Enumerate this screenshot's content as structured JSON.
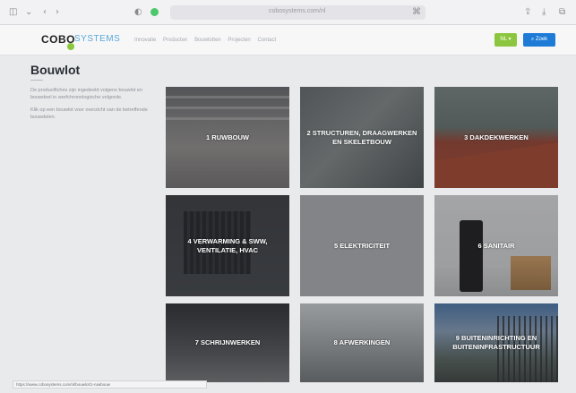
{
  "browser": {
    "back_icon": "chevron-left",
    "url": "cobosystems.com/nl"
  },
  "header": {
    "logo": {
      "brand": "COBO",
      "suffix": "SYSTEMS"
    },
    "nav": [
      "Innovatie",
      "Producten",
      "Bouwlotten",
      "Projecten",
      "Contact"
    ],
    "nl_button": "NL ▾",
    "search_button": "⌕ Zoek",
    "colors": {
      "green": "#8cc63f",
      "blue": "#1e7bd6"
    }
  },
  "page": {
    "title": "Bouwlot",
    "intro_1": "De productfiches zijn ingedeeld volgens bouwlot en bouwdeel in werfchronologische volgorde.",
    "intro_2": "Klik op een bouwlot voor overzicht van de betreffende bouwdelen."
  },
  "tiles": [
    {
      "label": "1 RUWBOUW"
    },
    {
      "label": "2 STRUCTUREN, DRAAGWERKEN EN SKELETBOUW"
    },
    {
      "label": "3 DAKDEKWERKEN"
    },
    {
      "label": "4 VERWARMING & SWW, VENTILATIE, HVAC"
    },
    {
      "label": "5 ELEKTRICITEIT"
    },
    {
      "label": "6 SANITAIR"
    },
    {
      "label": "7 SCHRIJNWERKEN"
    },
    {
      "label": "8 AFWERKINGEN"
    },
    {
      "label": "9 BUITENINRICHTING EN BUITENINFRASTRUCTUUR"
    }
  ],
  "statusbar": {
    "text": "https://www.cobosystems.com/nl/bouwlot/1-ruwbouw"
  }
}
